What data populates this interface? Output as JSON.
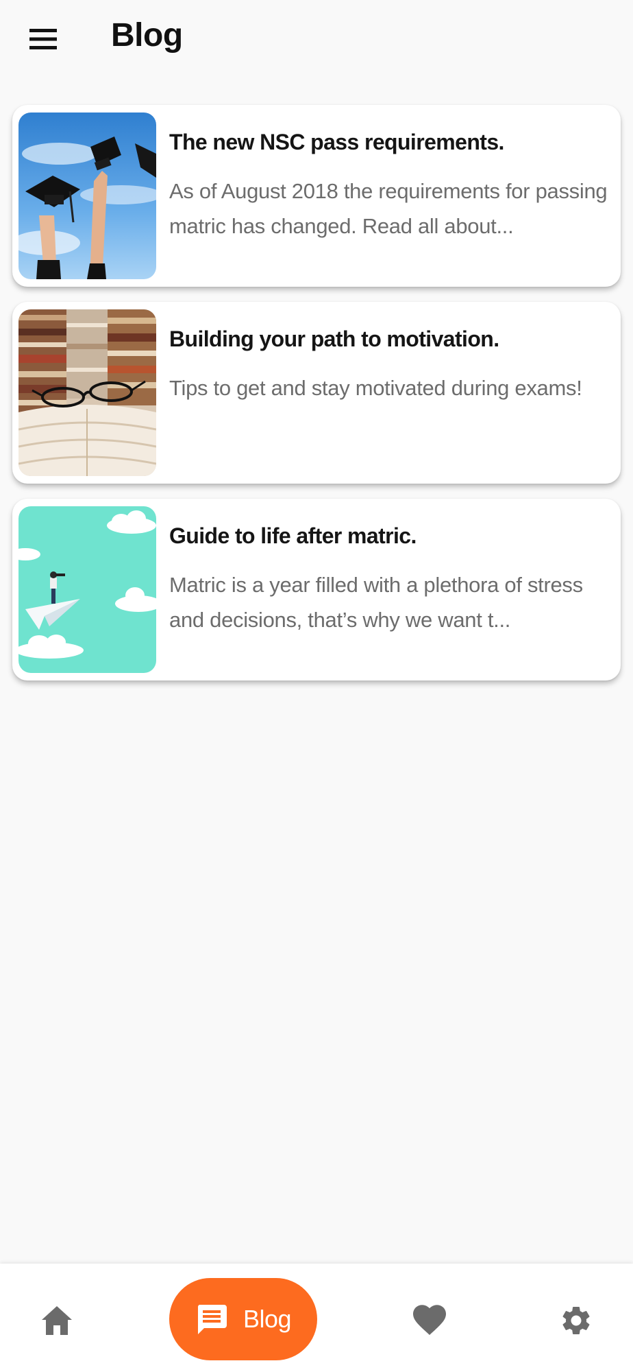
{
  "header": {
    "title": "Blog",
    "menu_icon": "hamburger-menu-icon"
  },
  "posts": [
    {
      "title": "The new NSC pass requirements.",
      "description": "As of August 2018 the requirements for passing matric has changed. Read all about...",
      "image": "graduation-caps-thrown-in-sky-photo"
    },
    {
      "title": "Building your path to motivation.",
      "description": "Tips to get and stay motivated during exams!",
      "image": "glasses-on-open-book-with-book-stacks-photo"
    },
    {
      "title": "Guide to life after matric.",
      "description": "Matric is a year filled with a plethora of stress and decisions, that’s why we want t...",
      "image": "person-on-paper-plane-among-clouds-illustration"
    }
  ],
  "bottom_nav": {
    "items": [
      {
        "icon": "home-icon",
        "label": ""
      },
      {
        "icon": "chat-icon",
        "label": "Blog",
        "active": true
      },
      {
        "icon": "heart-icon",
        "label": ""
      },
      {
        "icon": "gear-icon",
        "label": ""
      }
    ]
  },
  "colors": {
    "accent": "#fd6b1f",
    "background": "#f9f9f9",
    "icon_inactive": "#6b6b6b",
    "title_text": "#151515",
    "description_text": "#6c6c6c"
  }
}
